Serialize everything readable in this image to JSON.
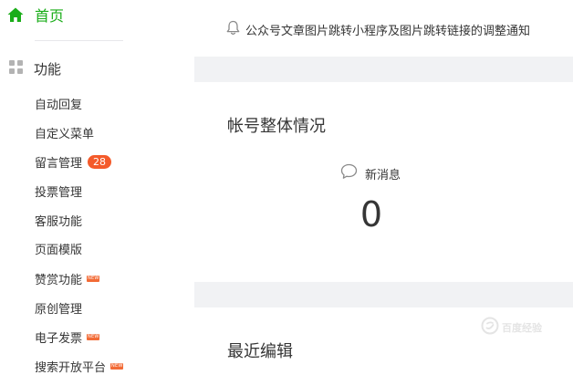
{
  "sidebar": {
    "home_label": "首页",
    "home_color": "#1aad19",
    "section_label": "功能",
    "items": [
      {
        "label": "自动回复"
      },
      {
        "label": "自定义菜单"
      },
      {
        "label": "留言管理",
        "badge": "28"
      },
      {
        "label": "投票管理"
      },
      {
        "label": "客服功能"
      },
      {
        "label": "页面模版"
      },
      {
        "label": "赞赏功能",
        "tag": "NEW"
      },
      {
        "label": "原创管理"
      },
      {
        "label": "电子发票",
        "tag": "NEW"
      },
      {
        "label": "搜索开放平台",
        "tag": "NEW"
      }
    ]
  },
  "notice": {
    "icon": "bell-icon",
    "text": "公众号文章图片跳转小程序及图片跳转链接的调整通知"
  },
  "overview": {
    "title": "帐号整体情况",
    "stat_icon": "chat-bubble-icon",
    "stat_label": "新消息",
    "stat_value": "0"
  },
  "recent": {
    "title": "最近编辑"
  },
  "watermark": {
    "text": "百度经验"
  }
}
